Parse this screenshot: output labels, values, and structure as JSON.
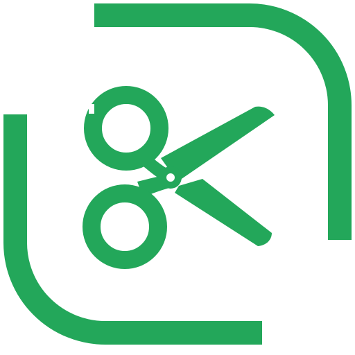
{
  "app_icon": {
    "name": "scissors-icon",
    "frame": "rounded-corner-brackets",
    "colors": {
      "accent": "#23a75a",
      "background": "#ffffff"
    }
  }
}
